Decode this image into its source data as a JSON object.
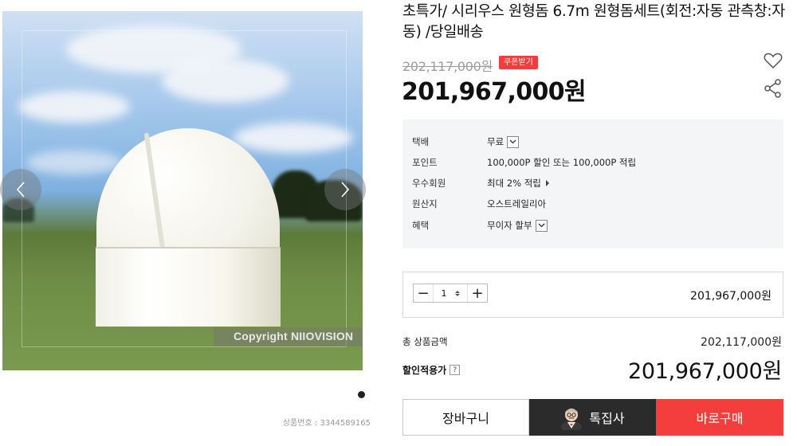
{
  "product": {
    "title": "초특가/ 시리우스 원형돔 6.7m 원형돔세트(회전:자동 관측창:자동) /당일배송",
    "original_price": "202,117,000원",
    "coupon_label": "쿠폰받기",
    "sale_price": "201,967,000원",
    "product_number": "상품번호 : 3344589165",
    "image_watermark": "Copyright NIIOVISION"
  },
  "icons": {
    "wishlist": "heart-icon",
    "share": "share-icon",
    "prev": "chevron-left-icon",
    "next": "chevron-right-icon"
  },
  "info": [
    {
      "key": "택배",
      "value": "무료",
      "control": "dropdown"
    },
    {
      "key": "포인트",
      "value": "100,000P 할인 또는 100,000P 적립",
      "control": "none"
    },
    {
      "key": "우수회원",
      "value": "최대 2% 적립",
      "control": "arrow"
    },
    {
      "key": "원산지",
      "value": "오스트레일리아",
      "control": "none"
    },
    {
      "key": "혜택",
      "value": "무이자 할부",
      "control": "dropdown"
    }
  ],
  "quantity": {
    "minus": "−",
    "value": "1",
    "plus": "+",
    "line_price": "201,967,000원"
  },
  "totals": {
    "total_label": "총 상품금액",
    "total_value": "202,117,000원",
    "discount_label": "할인적용가",
    "discount_help": "?",
    "discount_value": "201,967,000원"
  },
  "actions": {
    "cart": "장바구니",
    "special": "톡집사",
    "buy": "바로구매"
  },
  "colors": {
    "accent_red": "#f43e3e",
    "dark_button": "#2b2b2b",
    "coupon_red": "#ef3e3e"
  },
  "gallery": {
    "current_slide": 1,
    "total_slides": 1
  }
}
